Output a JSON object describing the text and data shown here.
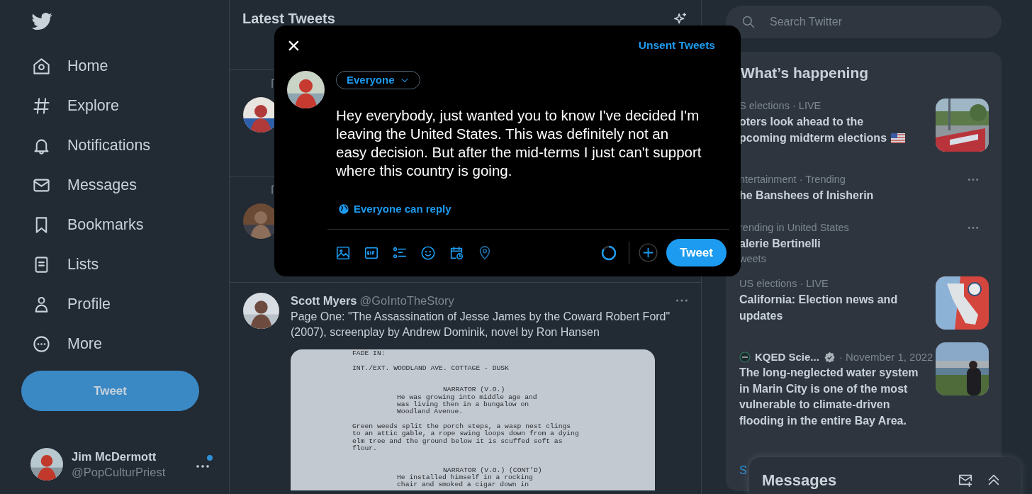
{
  "sidebar": {
    "items": [
      {
        "label": "Home"
      },
      {
        "label": "Explore"
      },
      {
        "label": "Notifications"
      },
      {
        "label": "Messages"
      },
      {
        "label": "Bookmarks"
      },
      {
        "label": "Lists"
      },
      {
        "label": "Profile"
      },
      {
        "label": "More"
      }
    ],
    "tweet_button": "Tweet",
    "account": {
      "name": "Jim McDermott",
      "handle": "@PopCulturPriest",
      "has_notification": true
    }
  },
  "timeline": {
    "title": "Latest Tweets",
    "tweets": [
      {
        "kind": "retweet_covered"
      },
      {
        "kind": "retweet_covered"
      },
      {
        "kind": "full",
        "author": "Scott Myers",
        "handle": "@GoIntoTheStory",
        "text": "Page One: \"The Assassination of Jesse James by the Coward Robert Ford\" (2007), screenplay by Andrew Dominik, novel by Ron Hansen",
        "document": [
          {
            "kind": "action",
            "lines": [
              "FADE IN:"
            ]
          },
          {
            "kind": "action",
            "lines": [
              "INT./EXT. WOODLAND AVE. COTTAGE - DUSK"
            ]
          },
          {
            "kind": "character",
            "lines": [
              "NARRATOR (V.O.)"
            ]
          },
          {
            "kind": "dialogue",
            "lines": [
              "He was growing into middle age and",
              "was living then in a bungalow on",
              "Woodland Avenue."
            ]
          },
          {
            "kind": "action",
            "lines": [
              "Green weeds split the porch steps, a wasp nest clings",
              "to an attic gable, a rope swing loops down from a dying",
              "elm tree and the ground below it is scuffed soft as",
              "flour."
            ]
          },
          {
            "kind": "character",
            "lines": [
              "NARRATOR (V.O.) (CONT’D)"
            ]
          },
          {
            "kind": "dialogue",
            "lines": [
              "He installed himself in a rocking",
              "chair and smoked a cigar down in"
            ]
          }
        ]
      }
    ]
  },
  "compose": {
    "close": "×",
    "unsent": "Unsent Tweets",
    "audience": "Everyone",
    "text": "Hey everybody, just wanted you to know I've decided I'm leaving the United States. This was definitely not an easy decision. But after the mid-terms I just can't support where this country is going.",
    "reply_setting": "Everyone can reply",
    "tweet_button": "Tweet"
  },
  "search": {
    "placeholder": "Search Twitter"
  },
  "trends": {
    "title": "What’s happening",
    "items": [
      {
        "kind": "trend",
        "context": "S elections · LIVE",
        "lines": [
          "oters look ahead to the",
          "pcoming midterm elections"
        ],
        "flag": true,
        "thumbnail": true
      },
      {
        "kind": "trend",
        "context": "ntertainment · Trending",
        "lines": [
          "he Banshees of Inisherin"
        ]
      },
      {
        "kind": "trend",
        "context": "rending in United States",
        "lines": [
          "alerie Bertinelli"
        ],
        "count": "weets"
      },
      {
        "kind": "trend",
        "context": "US elections · LIVE",
        "lines": [
          "California: Election news and",
          "updates"
        ],
        "thumbnail": true
      },
      {
        "kind": "news",
        "source": "KQED Scie...",
        "verified": true,
        "date": "· November 1, 2022",
        "lines": [
          "The long-neglected water system",
          "in Marin City is one of the most",
          "vulnerable to climate-driven",
          "flooding in the entire Bay Area."
        ],
        "thumbnail": true
      }
    ],
    "show_more": "S"
  },
  "messages_drawer": {
    "title": "Messages"
  }
}
